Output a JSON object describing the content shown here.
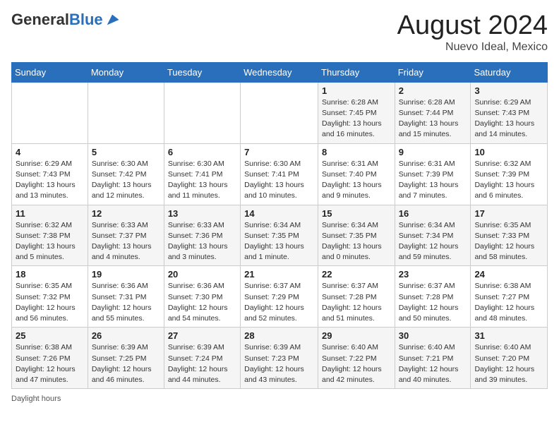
{
  "header": {
    "logo_general": "General",
    "logo_blue": "Blue",
    "month_year": "August 2024",
    "location": "Nuevo Ideal, Mexico"
  },
  "weekdays": [
    "Sunday",
    "Monday",
    "Tuesday",
    "Wednesday",
    "Thursday",
    "Friday",
    "Saturday"
  ],
  "weeks": [
    [
      {
        "day": "",
        "info": ""
      },
      {
        "day": "",
        "info": ""
      },
      {
        "day": "",
        "info": ""
      },
      {
        "day": "",
        "info": ""
      },
      {
        "day": "1",
        "info": "Sunrise: 6:28 AM\nSunset: 7:45 PM\nDaylight: 13 hours and 16 minutes."
      },
      {
        "day": "2",
        "info": "Sunrise: 6:28 AM\nSunset: 7:44 PM\nDaylight: 13 hours and 15 minutes."
      },
      {
        "day": "3",
        "info": "Sunrise: 6:29 AM\nSunset: 7:43 PM\nDaylight: 13 hours and 14 minutes."
      }
    ],
    [
      {
        "day": "4",
        "info": "Sunrise: 6:29 AM\nSunset: 7:43 PM\nDaylight: 13 hours and 13 minutes."
      },
      {
        "day": "5",
        "info": "Sunrise: 6:30 AM\nSunset: 7:42 PM\nDaylight: 13 hours and 12 minutes."
      },
      {
        "day": "6",
        "info": "Sunrise: 6:30 AM\nSunset: 7:41 PM\nDaylight: 13 hours and 11 minutes."
      },
      {
        "day": "7",
        "info": "Sunrise: 6:30 AM\nSunset: 7:41 PM\nDaylight: 13 hours and 10 minutes."
      },
      {
        "day": "8",
        "info": "Sunrise: 6:31 AM\nSunset: 7:40 PM\nDaylight: 13 hours and 9 minutes."
      },
      {
        "day": "9",
        "info": "Sunrise: 6:31 AM\nSunset: 7:39 PM\nDaylight: 13 hours and 7 minutes."
      },
      {
        "day": "10",
        "info": "Sunrise: 6:32 AM\nSunset: 7:39 PM\nDaylight: 13 hours and 6 minutes."
      }
    ],
    [
      {
        "day": "11",
        "info": "Sunrise: 6:32 AM\nSunset: 7:38 PM\nDaylight: 13 hours and 5 minutes."
      },
      {
        "day": "12",
        "info": "Sunrise: 6:33 AM\nSunset: 7:37 PM\nDaylight: 13 hours and 4 minutes."
      },
      {
        "day": "13",
        "info": "Sunrise: 6:33 AM\nSunset: 7:36 PM\nDaylight: 13 hours and 3 minutes."
      },
      {
        "day": "14",
        "info": "Sunrise: 6:34 AM\nSunset: 7:35 PM\nDaylight: 13 hours and 1 minute."
      },
      {
        "day": "15",
        "info": "Sunrise: 6:34 AM\nSunset: 7:35 PM\nDaylight: 13 hours and 0 minutes."
      },
      {
        "day": "16",
        "info": "Sunrise: 6:34 AM\nSunset: 7:34 PM\nDaylight: 12 hours and 59 minutes."
      },
      {
        "day": "17",
        "info": "Sunrise: 6:35 AM\nSunset: 7:33 PM\nDaylight: 12 hours and 58 minutes."
      }
    ],
    [
      {
        "day": "18",
        "info": "Sunrise: 6:35 AM\nSunset: 7:32 PM\nDaylight: 12 hours and 56 minutes."
      },
      {
        "day": "19",
        "info": "Sunrise: 6:36 AM\nSunset: 7:31 PM\nDaylight: 12 hours and 55 minutes."
      },
      {
        "day": "20",
        "info": "Sunrise: 6:36 AM\nSunset: 7:30 PM\nDaylight: 12 hours and 54 minutes."
      },
      {
        "day": "21",
        "info": "Sunrise: 6:37 AM\nSunset: 7:29 PM\nDaylight: 12 hours and 52 minutes."
      },
      {
        "day": "22",
        "info": "Sunrise: 6:37 AM\nSunset: 7:28 PM\nDaylight: 12 hours and 51 minutes."
      },
      {
        "day": "23",
        "info": "Sunrise: 6:37 AM\nSunset: 7:28 PM\nDaylight: 12 hours and 50 minutes."
      },
      {
        "day": "24",
        "info": "Sunrise: 6:38 AM\nSunset: 7:27 PM\nDaylight: 12 hours and 48 minutes."
      }
    ],
    [
      {
        "day": "25",
        "info": "Sunrise: 6:38 AM\nSunset: 7:26 PM\nDaylight: 12 hours and 47 minutes."
      },
      {
        "day": "26",
        "info": "Sunrise: 6:39 AM\nSunset: 7:25 PM\nDaylight: 12 hours and 46 minutes."
      },
      {
        "day": "27",
        "info": "Sunrise: 6:39 AM\nSunset: 7:24 PM\nDaylight: 12 hours and 44 minutes."
      },
      {
        "day": "28",
        "info": "Sunrise: 6:39 AM\nSunset: 7:23 PM\nDaylight: 12 hours and 43 minutes."
      },
      {
        "day": "29",
        "info": "Sunrise: 6:40 AM\nSunset: 7:22 PM\nDaylight: 12 hours and 42 minutes."
      },
      {
        "day": "30",
        "info": "Sunrise: 6:40 AM\nSunset: 7:21 PM\nDaylight: 12 hours and 40 minutes."
      },
      {
        "day": "31",
        "info": "Sunrise: 6:40 AM\nSunset: 7:20 PM\nDaylight: 12 hours and 39 minutes."
      }
    ]
  ],
  "footer": {
    "daylight_label": "Daylight hours"
  }
}
